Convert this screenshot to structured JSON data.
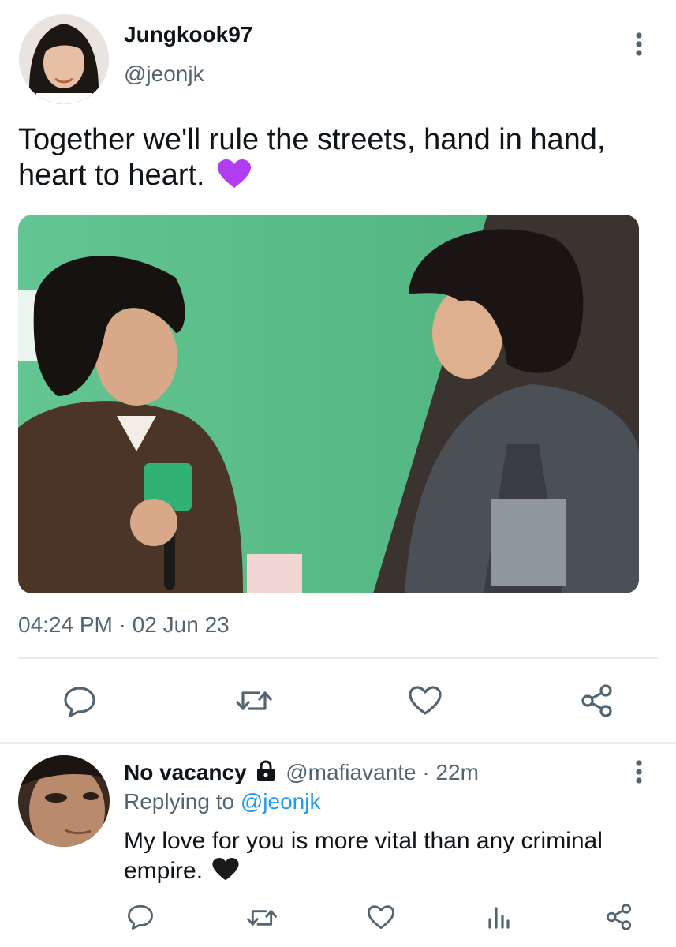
{
  "tweet": {
    "display_name": "Jungkook97",
    "handle": "@jeonjk",
    "text_line1": "Together we'll rule the streets, hand in hand,",
    "text_line2": "heart to heart.",
    "emoji": "💜",
    "timestamp": "04:24 PM · 02 Jun 23"
  },
  "reply": {
    "display_name": "No vacancy",
    "handle_time": "@mafiavante · 22m",
    "replying_prefix": "Replying to",
    "replying_handle": "@jeonjk",
    "text_line1": "My love for you is more vital than any criminal",
    "text_line2": "empire.",
    "emoji": "🖤"
  },
  "icons": {
    "more": "more-vertical-icon",
    "reply": "reply-icon",
    "retweet": "retweet-icon",
    "like": "heart-icon",
    "share": "share-icon",
    "analytics": "analytics-icon",
    "lock": "lock-icon"
  },
  "colors": {
    "text": "#0f1419",
    "muted": "#536471",
    "link": "#1d9bf0",
    "photo_bg": "#5fbf8c",
    "emoji_purple": "#b23cf0"
  }
}
